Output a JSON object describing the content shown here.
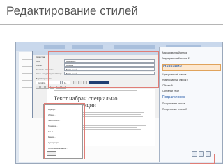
{
  "slide": {
    "title": "Редактирование стилей"
  },
  "dialog": {
    "header": "Свойства",
    "rows": [
      {
        "label": "Имя:",
        "value": "Название"
      },
      {
        "label": "Стиль:",
        "value": "Абзаца"
      },
      {
        "label": "Основан на стиле:",
        "value": "¶ Обычный"
      },
      {
        "label": "Стиль следующего абзаца:",
        "value": "¶ Обычный"
      }
    ],
    "format_label": "Форматирование",
    "font": "Cambria",
    "size": "14"
  },
  "preview": {
    "text": "Текст набран специально для конструкции"
  },
  "format_menu": {
    "items": [
      "Шрифт...",
      "Абзац...",
      "Табуляция...",
      "Граница...",
      "Язык...",
      "Рамка...",
      "Нумерация...",
      "Сочетание клавиш..."
    ],
    "ok": "Формат"
  },
  "styles_pane": {
    "items": [
      {
        "label": "Маркированный список",
        "kind": "normal"
      },
      {
        "label": "Маркированный список 2",
        "kind": "normal"
      },
      {
        "label": "Название",
        "kind": "heading1"
      },
      {
        "label": "Нумерованный список",
        "kind": "normal"
      },
      {
        "label": "Нумерованный список 2",
        "kind": "normal"
      },
      {
        "label": "Обычный",
        "kind": "normal"
      },
      {
        "label": "Основной текст",
        "kind": "normal"
      },
      {
        "label": "Подзаголовок",
        "kind": "h"
      },
      {
        "label": "Продолжение списка",
        "kind": "normal"
      },
      {
        "label": "Продолжение списка 2",
        "kind": "normal"
      }
    ]
  }
}
